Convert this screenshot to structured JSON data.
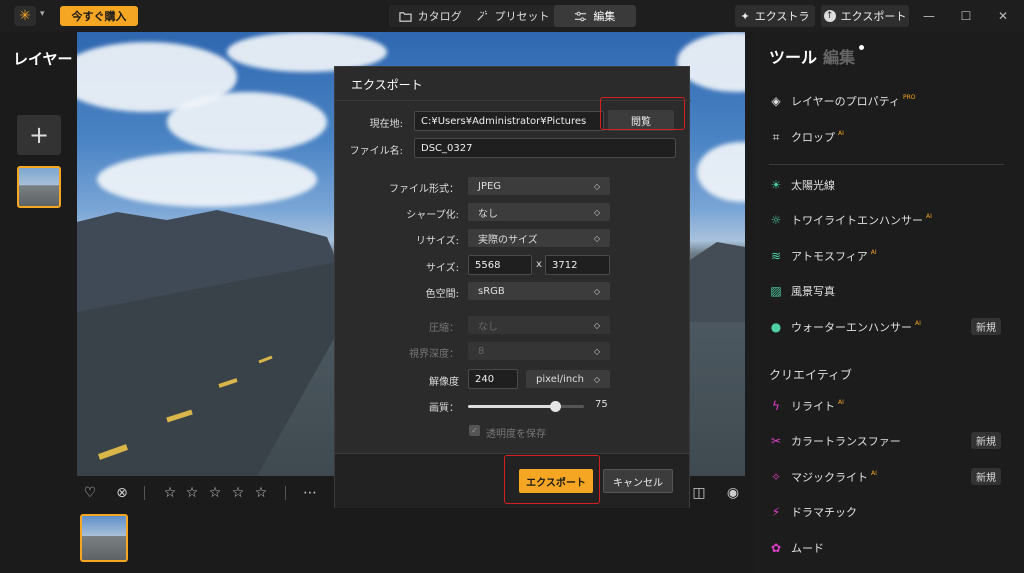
{
  "topbar": {
    "buy_label": "今すぐ購入",
    "tabs": [
      {
        "label": "カタログ",
        "icon": "folder-icon"
      },
      {
        "label": "プリセット",
        "icon": "magic-wand-icon"
      },
      {
        "label": "編集",
        "icon": "sliders-icon"
      }
    ],
    "extras_label": "エクストラ",
    "export_label": "エクスポート"
  },
  "left_panel": {
    "title": "レイヤー"
  },
  "right_panel": {
    "tab_tools": "ツール",
    "tab_edit": "編集",
    "tools": [
      {
        "label": "レイヤーのプロパティ",
        "tag": "PRO"
      },
      {
        "label": "クロップ",
        "tag": "AI"
      },
      {
        "label": "太陽光線",
        "tag": ""
      },
      {
        "label": "トワイライトエンハンサー",
        "tag": "AI"
      },
      {
        "label": "アトモスフィア",
        "tag": "AI"
      },
      {
        "label": "風景写真",
        "tag": ""
      },
      {
        "label": "ウォーターエンハンサー",
        "tag": "AI",
        "badge": "新規"
      }
    ],
    "creative_title": "クリエイティブ",
    "creative_tools": [
      {
        "label": "リライト",
        "tag": "AI"
      },
      {
        "label": "カラートランスファー",
        "tag": "",
        "badge": "新規"
      },
      {
        "label": "マジックライト",
        "tag": "AI",
        "badge": "新規"
      },
      {
        "label": "ドラマチック",
        "tag": ""
      },
      {
        "label": "ムード",
        "tag": ""
      }
    ]
  },
  "dialog": {
    "title": "エクスポート",
    "location_label": "現在地:",
    "location_value": "C:¥Users¥Administrator¥Pictures",
    "browse_label": "閲覧",
    "filename_label": "ファイル名:",
    "filename_value": "DSC_0327",
    "format_label": "ファイル形式：",
    "format_value": "JPEG",
    "sharpen_label": "シャープ化:",
    "sharpen_value": "なし",
    "resize_label": "リサイズ:",
    "resize_value": "実際のサイズ",
    "size_label": "サイズ:",
    "width_value": "5568",
    "size_x": "x",
    "height_value": "3712",
    "colorspace_label": "色空間:",
    "colorspace_value": "sRGB",
    "compression_label": "圧縮：",
    "compression_value": "なし",
    "bitdepth_label": "視界深度：",
    "bitdepth_value": "8",
    "resolution_label": "解像度",
    "resolution_value": "240",
    "resolution_unit": "pixel/inch",
    "quality_label": "画質：",
    "quality_value": "75",
    "quality_fraction": 0.75,
    "transparency_label": "透明度を保存",
    "export_label": "エクスポート",
    "cancel_label": "キャンセル"
  },
  "colors": {
    "accent": "#f5a623",
    "highlight": "#d42020"
  }
}
